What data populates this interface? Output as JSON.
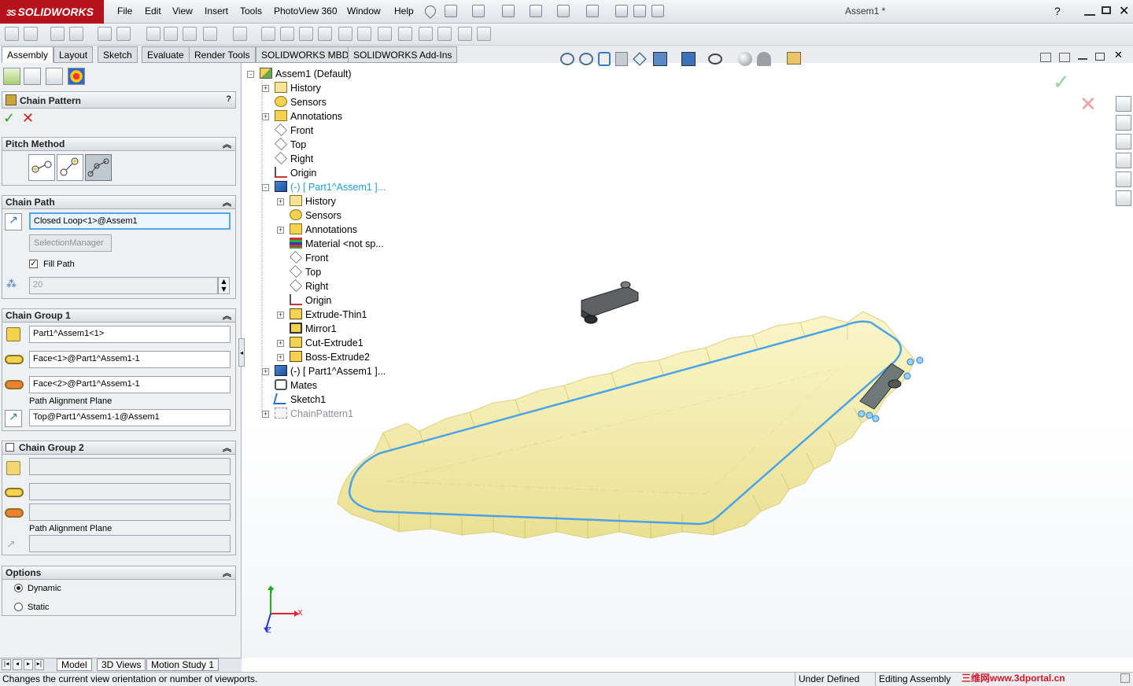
{
  "app": {
    "brand": "SOLIDWORKS",
    "brand_ds": "3S",
    "document_title": "Assem1 *",
    "menu": [
      "File",
      "Edit",
      "View",
      "Insert",
      "Tools",
      "PhotoView 360",
      "Window",
      "Help"
    ],
    "help_icon": "?"
  },
  "command_tabs": [
    "Assembly",
    "Layout",
    "Sketch",
    "Evaluate",
    "Render Tools",
    "SOLIDWORKS MBD",
    "SOLIDWORKS Add-Ins"
  ],
  "property_manager": {
    "title": "Chain Pattern",
    "help": "?",
    "ok_icon": "check-icon",
    "cancel_icon": "cross-icon",
    "pitch_method": {
      "label": "Pitch Method"
    },
    "chain_path": {
      "label": "Chain Path",
      "path_value": "Closed Loop<1>@Assem1",
      "selection_manager": "SelectionManager",
      "fill_path_label": "Fill Path",
      "fill_path_checked": true,
      "instances": "20"
    },
    "chain_group_1": {
      "label": "Chain Group 1",
      "component": "Part1^Assem1<1>",
      "path_link_1": "Face<1>@Part1^Assem1-1",
      "path_link_2": "Face<2>@Part1^Assem1-1",
      "alignment_label": "Path Alignment Plane",
      "alignment_value": "Top@Part1^Assem1-1@Assem1"
    },
    "chain_group_2": {
      "label": "Chain Group 2",
      "alignment_label": "Path Alignment Plane"
    },
    "options": {
      "label": "Options",
      "dynamic": "Dynamic",
      "static": "Static",
      "selected": "Dynamic"
    }
  },
  "tree": [
    {
      "label": "Assem1  (Default)",
      "level": 0,
      "expander": "-",
      "icon": "assembly-icon"
    },
    {
      "label": "History",
      "level": 1,
      "expander": "+",
      "icon": "history-icon"
    },
    {
      "label": "Sensors",
      "level": 1,
      "expander": "",
      "icon": "sensor-icon"
    },
    {
      "label": "Annotations",
      "level": 1,
      "expander": "+",
      "icon": "annotation-icon"
    },
    {
      "label": "Front",
      "level": 1,
      "expander": "",
      "icon": "plane-icon"
    },
    {
      "label": "Top",
      "level": 1,
      "expander": "",
      "icon": "plane-icon"
    },
    {
      "label": "Right",
      "level": 1,
      "expander": "",
      "icon": "plane-icon"
    },
    {
      "label": "Origin",
      "level": 1,
      "expander": "",
      "icon": "origin-icon"
    },
    {
      "label": "(-) [ Part1^Assem1 ]...",
      "level": 1,
      "expander": "-",
      "icon": "part-icon",
      "highlight": true
    },
    {
      "label": "History",
      "level": 2,
      "expander": "+",
      "icon": "history-icon"
    },
    {
      "label": "Sensors",
      "level": 2,
      "expander": "",
      "icon": "sensor-icon"
    },
    {
      "label": "Annotations",
      "level": 2,
      "expander": "+",
      "icon": "annotation-icon"
    },
    {
      "label": "Material <not sp...",
      "level": 2,
      "expander": "",
      "icon": "material-icon"
    },
    {
      "label": "Front",
      "level": 2,
      "expander": "",
      "icon": "plane-icon"
    },
    {
      "label": "Top",
      "level": 2,
      "expander": "",
      "icon": "plane-icon"
    },
    {
      "label": "Right",
      "level": 2,
      "expander": "",
      "icon": "plane-icon"
    },
    {
      "label": "Origin",
      "level": 2,
      "expander": "",
      "icon": "origin-icon"
    },
    {
      "label": "Extrude-Thin1",
      "level": 2,
      "expander": "+",
      "icon": "feature-icon"
    },
    {
      "label": "Mirror1",
      "level": 2,
      "expander": "",
      "icon": "mirror-icon"
    },
    {
      "label": "Cut-Extrude1",
      "level": 2,
      "expander": "+",
      "icon": "feature-icon"
    },
    {
      "label": "Boss-Extrude2",
      "level": 2,
      "expander": "+",
      "icon": "feature-icon"
    },
    {
      "label": "(-) [ Part1^Assem1 ]...",
      "level": 1,
      "expander": "+",
      "icon": "part-icon"
    },
    {
      "label": "Mates",
      "level": 1,
      "expander": "",
      "icon": "mates-icon"
    },
    {
      "label": "Sketch1",
      "level": 1,
      "expander": "",
      "icon": "sketch-icon"
    },
    {
      "label": "ChainPattern1",
      "level": 1,
      "expander": "+",
      "icon": "chain-pattern-icon",
      "dim": true
    }
  ],
  "triad": {
    "x": "X",
    "y": "Y",
    "z": "Z"
  },
  "bottom_tabs": [
    "Model",
    "3D Views",
    "Motion Study 1"
  ],
  "status": {
    "message": "Changes the current view orientation or number of viewports.",
    "state": "Under Defined",
    "mode": "Editing Assembly",
    "watermark": "三维网www.3dportal.cn"
  },
  "colors": {
    "brand_red": "#b5121b",
    "accent_blue": "#56a6e4",
    "chain_yellow": "#f2eaa3",
    "path_blue": "#4aa3e8",
    "ok_green": "#2e9e2e",
    "cancel_red": "#cc1f1f"
  }
}
